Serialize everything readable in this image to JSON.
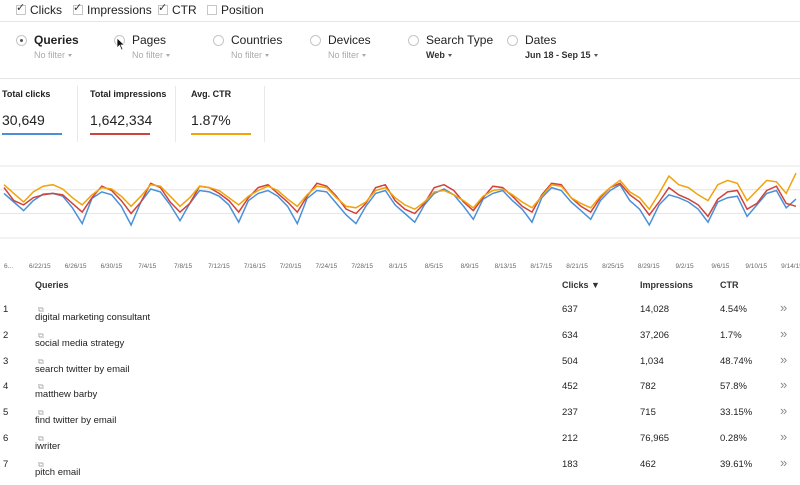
{
  "metrics": [
    {
      "label": "Clicks",
      "checked": true
    },
    {
      "label": "Impressions",
      "checked": true
    },
    {
      "label": "CTR",
      "checked": true
    },
    {
      "label": "Position",
      "checked": false
    }
  ],
  "dimensions": [
    {
      "label": "Queries",
      "filter": "No filter",
      "selected": true
    },
    {
      "label": "Pages",
      "filter": "No filter",
      "selected": false
    },
    {
      "label": "Countries",
      "filter": "No filter",
      "selected": false
    },
    {
      "label": "Devices",
      "filter": "No filter",
      "selected": false
    },
    {
      "label": "Search Type",
      "filter": "Web",
      "selected": false
    },
    {
      "label": "Dates",
      "filter": "Jun 18 - Sep 15",
      "selected": false
    }
  ],
  "totals": [
    {
      "name": "Total clicks",
      "value": "30,649",
      "color": "#4a90d9"
    },
    {
      "name": "Total impressions",
      "value": "1,642,334",
      "color": "#d0433a"
    },
    {
      "name": "Avg. CTR",
      "value": "1.87%",
      "color": "#f0a30a"
    }
  ],
  "chart_data": {
    "type": "line",
    "x_tick_labels": [
      "6...",
      "6/22/15",
      "6/26/15",
      "6/30/15",
      "7/4/15",
      "7/8/15",
      "7/12/15",
      "7/16/15",
      "7/20/15",
      "7/24/15",
      "7/28/15",
      "8/1/15",
      "8/5/15",
      "8/9/15",
      "8/13/15",
      "8/17/15",
      "8/21/15",
      "8/25/15",
      "8/29/15",
      "9/2/15",
      "9/6/15",
      "9/10/15",
      "9/14/15"
    ],
    "grid": true,
    "series_colors": [
      "#4a90d9",
      "#d0433a",
      "#f0a30a"
    ],
    "series": [
      {
        "values": [
          0.62,
          0.5,
          0.38,
          0.52,
          0.61,
          0.62,
          0.58,
          0.42,
          0.2,
          0.55,
          0.64,
          0.6,
          0.44,
          0.18,
          0.5,
          0.68,
          0.64,
          0.46,
          0.24,
          0.48,
          0.66,
          0.64,
          0.58,
          0.46,
          0.22,
          0.52,
          0.62,
          0.66,
          0.58,
          0.44,
          0.2,
          0.55,
          0.66,
          0.64,
          0.48,
          0.32,
          0.2,
          0.44,
          0.62,
          0.66,
          0.46,
          0.34,
          0.22,
          0.46,
          0.62,
          0.68,
          0.6,
          0.44,
          0.26,
          0.54,
          0.62,
          0.66,
          0.52,
          0.4,
          0.22,
          0.56,
          0.7,
          0.66,
          0.5,
          0.38,
          0.26,
          0.52,
          0.66,
          0.74,
          0.52,
          0.4,
          0.18,
          0.46,
          0.6,
          0.56,
          0.5,
          0.4,
          0.22,
          0.5,
          0.56,
          0.58,
          0.3,
          0.46,
          0.62,
          0.66,
          0.42,
          0.54
        ]
      },
      {
        "values": [
          0.7,
          0.52,
          0.46,
          0.56,
          0.6,
          0.62,
          0.6,
          0.48,
          0.36,
          0.56,
          0.72,
          0.66,
          0.52,
          0.34,
          0.5,
          0.76,
          0.7,
          0.5,
          0.36,
          0.48,
          0.72,
          0.7,
          0.62,
          0.52,
          0.36,
          0.56,
          0.7,
          0.74,
          0.62,
          0.5,
          0.36,
          0.58,
          0.76,
          0.72,
          0.58,
          0.4,
          0.34,
          0.48,
          0.7,
          0.74,
          0.52,
          0.4,
          0.34,
          0.48,
          0.7,
          0.74,
          0.66,
          0.5,
          0.38,
          0.56,
          0.72,
          0.7,
          0.58,
          0.44,
          0.36,
          0.6,
          0.76,
          0.74,
          0.56,
          0.44,
          0.36,
          0.56,
          0.7,
          0.76,
          0.6,
          0.5,
          0.32,
          0.5,
          0.7,
          0.6,
          0.54,
          0.46,
          0.3,
          0.54,
          0.64,
          0.66,
          0.4,
          0.48,
          0.66,
          0.72,
          0.48,
          0.44
        ]
      },
      {
        "values": [
          0.74,
          0.62,
          0.5,
          0.64,
          0.72,
          0.74,
          0.68,
          0.56,
          0.46,
          0.6,
          0.7,
          0.68,
          0.58,
          0.44,
          0.58,
          0.74,
          0.72,
          0.58,
          0.44,
          0.56,
          0.72,
          0.7,
          0.66,
          0.56,
          0.46,
          0.58,
          0.66,
          0.72,
          0.66,
          0.54,
          0.44,
          0.6,
          0.72,
          0.7,
          0.56,
          0.44,
          0.42,
          0.5,
          0.66,
          0.7,
          0.56,
          0.46,
          0.4,
          0.5,
          0.64,
          0.66,
          0.6,
          0.52,
          0.42,
          0.58,
          0.66,
          0.68,
          0.6,
          0.5,
          0.42,
          0.58,
          0.74,
          0.72,
          0.56,
          0.48,
          0.42,
          0.58,
          0.7,
          0.8,
          0.64,
          0.56,
          0.4,
          0.62,
          0.86,
          0.74,
          0.7,
          0.6,
          0.52,
          0.74,
          0.8,
          0.76,
          0.52,
          0.66,
          0.8,
          0.78,
          0.62,
          0.9
        ]
      }
    ]
  },
  "table": {
    "headers": {
      "query": "Queries",
      "clicks": "Clicks ▼",
      "impressions": "Impressions",
      "ctr": "CTR"
    },
    "more_glyph": "»",
    "rows": [
      {
        "num": "1",
        "query": "digital marketing consultant",
        "clicks": "637",
        "impressions": "14,028",
        "ctr": "4.54%"
      },
      {
        "num": "2",
        "query": "social media strategy",
        "clicks": "634",
        "impressions": "37,206",
        "ctr": "1.7%"
      },
      {
        "num": "3",
        "query": "search twitter by email",
        "clicks": "504",
        "impressions": "1,034",
        "ctr": "48.74%"
      },
      {
        "num": "4",
        "query": "matthew barby",
        "clicks": "452",
        "impressions": "782",
        "ctr": "57.8%"
      },
      {
        "num": "5",
        "query": "find twitter by email",
        "clicks": "237",
        "impressions": "715",
        "ctr": "33.15%"
      },
      {
        "num": "6",
        "query": "iwriter",
        "clicks": "212",
        "impressions": "76,965",
        "ctr": "0.28%"
      },
      {
        "num": "7",
        "query": "pitch email",
        "clicks": "183",
        "impressions": "462",
        "ctr": "39.61%"
      }
    ]
  }
}
